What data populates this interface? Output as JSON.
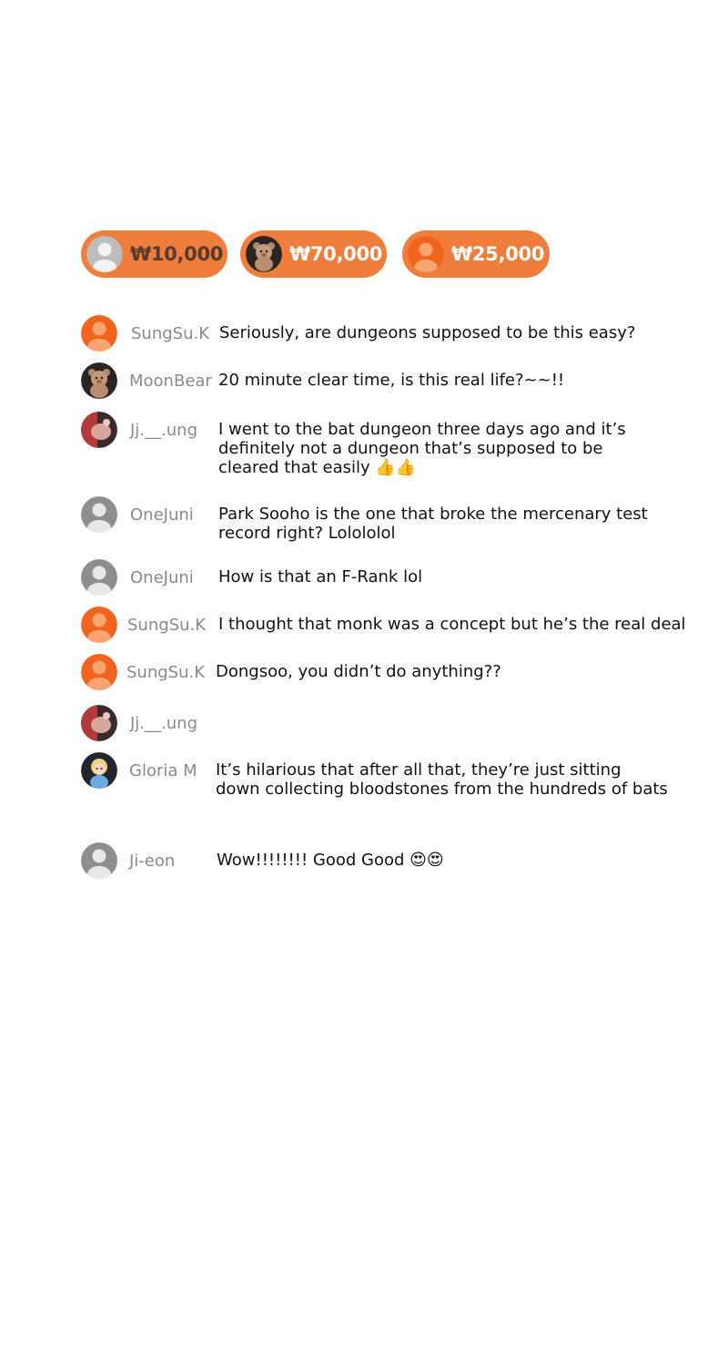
{
  "colors": {
    "accent": "#ef7d3c",
    "username": "#8a8a8a",
    "text": "#111111"
  },
  "donations": [
    {
      "avatar": "default-gray-avatar-icon",
      "amount": "₩10,000"
    },
    {
      "avatar": "teddy-bear-avatar-icon",
      "amount": "₩70,000"
    },
    {
      "avatar": "default-orange-avatar-icon",
      "amount": "₩25,000"
    }
  ],
  "comments": [
    {
      "user": "SungSu.K",
      "avatar": "default-orange-avatar-icon",
      "text": "Seriously, are dungeons supposed to be this easy?"
    },
    {
      "user": "MoonBear",
      "avatar": "teddy-bear-avatar-icon",
      "text": "20 minute clear time, is this real life?~~!!"
    },
    {
      "user": "Jj.__.ung",
      "avatar": "photo-avatar-icon",
      "text": "I went to the bat dungeon three days ago and it’s\ndefinitely not a dungeon that’s supposed to be\ncleared that easily 👍👍"
    },
    {
      "user": "OneJuni",
      "avatar": "default-gray-avatar-icon",
      "text": "Park Sooho is the one that broke the mercenary test\nrecord right? Lolololol"
    },
    {
      "user": "OneJuni",
      "avatar": "default-gray-avatar-icon",
      "text": "How is that an F-Rank lol"
    },
    {
      "user": "SungSu.K",
      "avatar": "default-orange-avatar-icon",
      "text": "I thought that monk was a concept but he’s the real deal"
    },
    {
      "user": "SungSu.K",
      "avatar": "default-orange-avatar-icon",
      "text": "Dongsoo, you didn’t do anything??"
    },
    {
      "user": "Jj.__.ung",
      "avatar": "photo-avatar-icon",
      "text": ""
    },
    {
      "user": "Gloria M",
      "avatar": "doll-avatar-icon",
      "text": "It’s hilarious that after all that, they’re just sitting\ndown collecting bloodstones from the hundreds of bats"
    },
    {
      "user": "Ji-eon",
      "avatar": "default-gray-avatar-icon",
      "text": "Wow!!!!!!!! Good Good 😍😍"
    }
  ]
}
